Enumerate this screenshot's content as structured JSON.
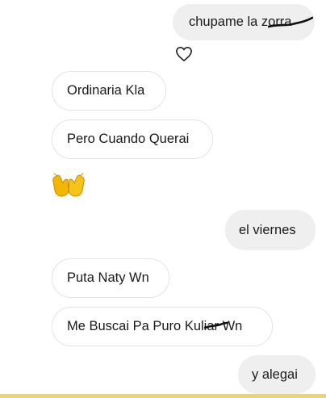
{
  "chat": {
    "messages": [
      {
        "id": 1,
        "side": "sent",
        "text": "chupame la zorra",
        "redacted": true
      },
      {
        "id": 2,
        "side": "received",
        "text": "Ordinaria Kla"
      },
      {
        "id": 3,
        "side": "received",
        "text": "Pero Cuando Querai"
      },
      {
        "id": 4,
        "side": "received",
        "emoji": "raising-hands-emoji"
      },
      {
        "id": 5,
        "side": "sent",
        "text": "el viernes"
      },
      {
        "id": 6,
        "side": "received",
        "text": "Puta Naty Wn"
      },
      {
        "id": 7,
        "side": "received",
        "text": "Me Buscai Pa Puro Kuliar Wn",
        "redacted": true
      },
      {
        "id": 8,
        "side": "sent",
        "text": "y alegai"
      }
    ],
    "reaction_icon": "heart-outline-icon"
  },
  "colors": {
    "sent_bubble_bg": "#efefef",
    "received_bubble_border": "#e3e3e3",
    "text": "#1a1a1a",
    "scribble": "#111111",
    "emoji": "#f2b705"
  }
}
